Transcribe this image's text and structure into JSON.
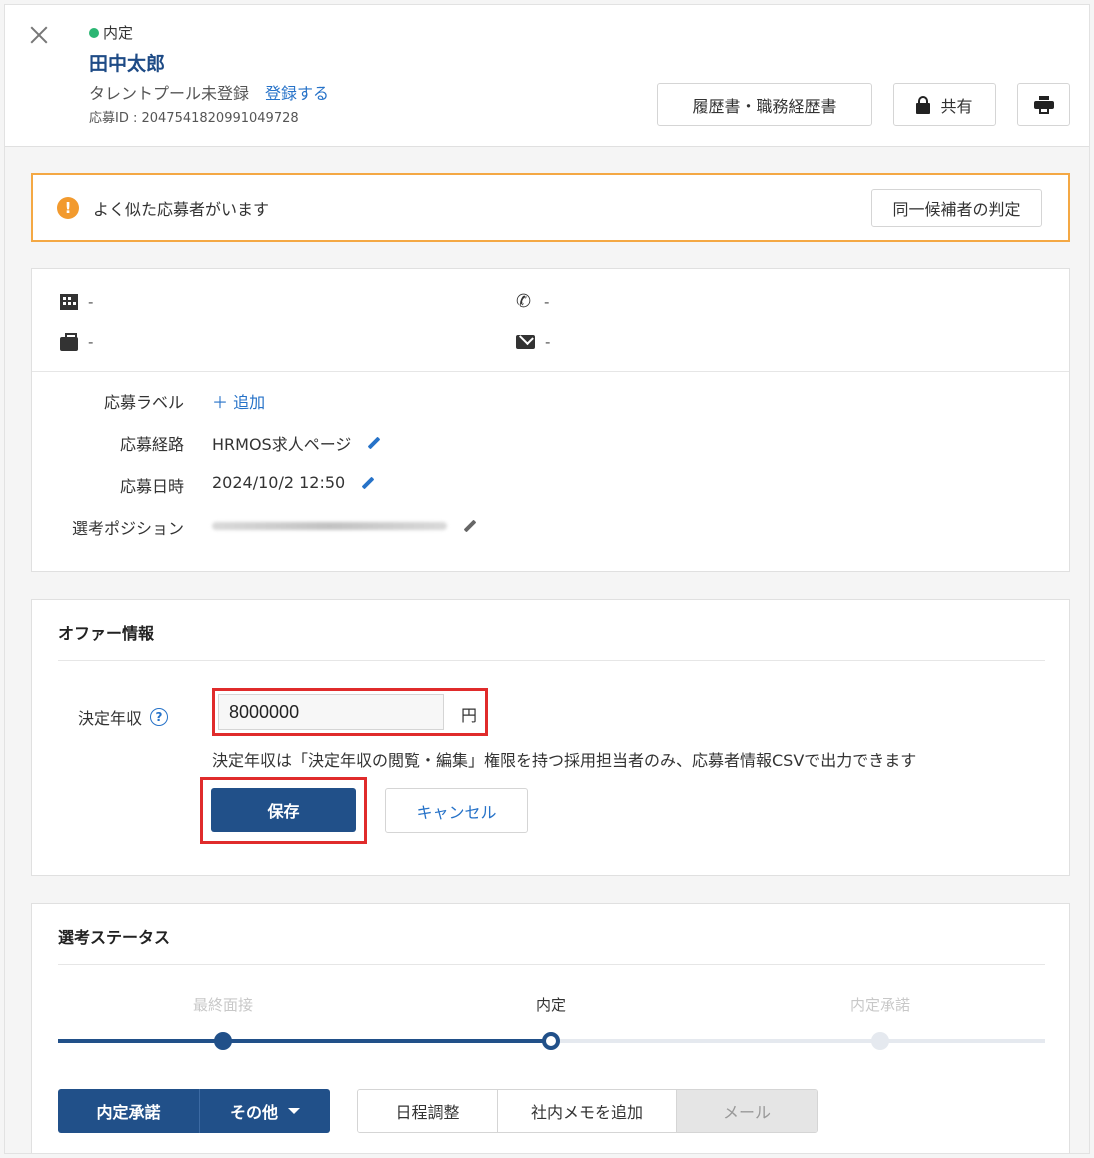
{
  "header": {
    "status": "内定",
    "name": "田中太郎",
    "pool_status": "タレントプール未登録",
    "register_link": "登録する",
    "application_id": "応募ID : 2047541820991049728",
    "resume_button": "履歴書・職務経歴書",
    "share_button": "共有"
  },
  "warning": {
    "message": "よく似た応募者がいます",
    "judge_button": "同一候補者の判定",
    "icon_glyph": "!"
  },
  "contact": {
    "company": "-",
    "phone": "-",
    "job": "-",
    "email": "-"
  },
  "details": {
    "label_field": "応募ラベル",
    "add_label": "＋ 追加",
    "route_field": "応募経路",
    "route_value": "HRMOS求人ページ",
    "date_field": "応募日時",
    "date_value": "2024/10/2 12:50",
    "position_field": "選考ポジション"
  },
  "offer": {
    "title": "オファー情報",
    "salary_label": "決定年収",
    "help_glyph": "?",
    "salary_value": "8000000",
    "unit": "円",
    "note": "決定年収は「決定年収の閲覧・編集」権限を持つ採用担当者のみ、応募者情報CSVで出力できます",
    "save_button": "保存",
    "cancel_button": "キャンセル"
  },
  "selection": {
    "title": "選考ステータス",
    "stages": [
      "最終面接",
      "内定",
      "内定承諾"
    ],
    "current_stage": "内定",
    "accept_button": "内定承諾",
    "other_button": "その他",
    "schedule_button": "日程調整",
    "memo_button": "社内メモを追加",
    "mail_button": "メール"
  },
  "colors": {
    "brand": "#215089",
    "link": "#2672c8",
    "warning": "#f29a2e",
    "highlight": "#e02b2b",
    "status_dot": "#2bb673"
  }
}
